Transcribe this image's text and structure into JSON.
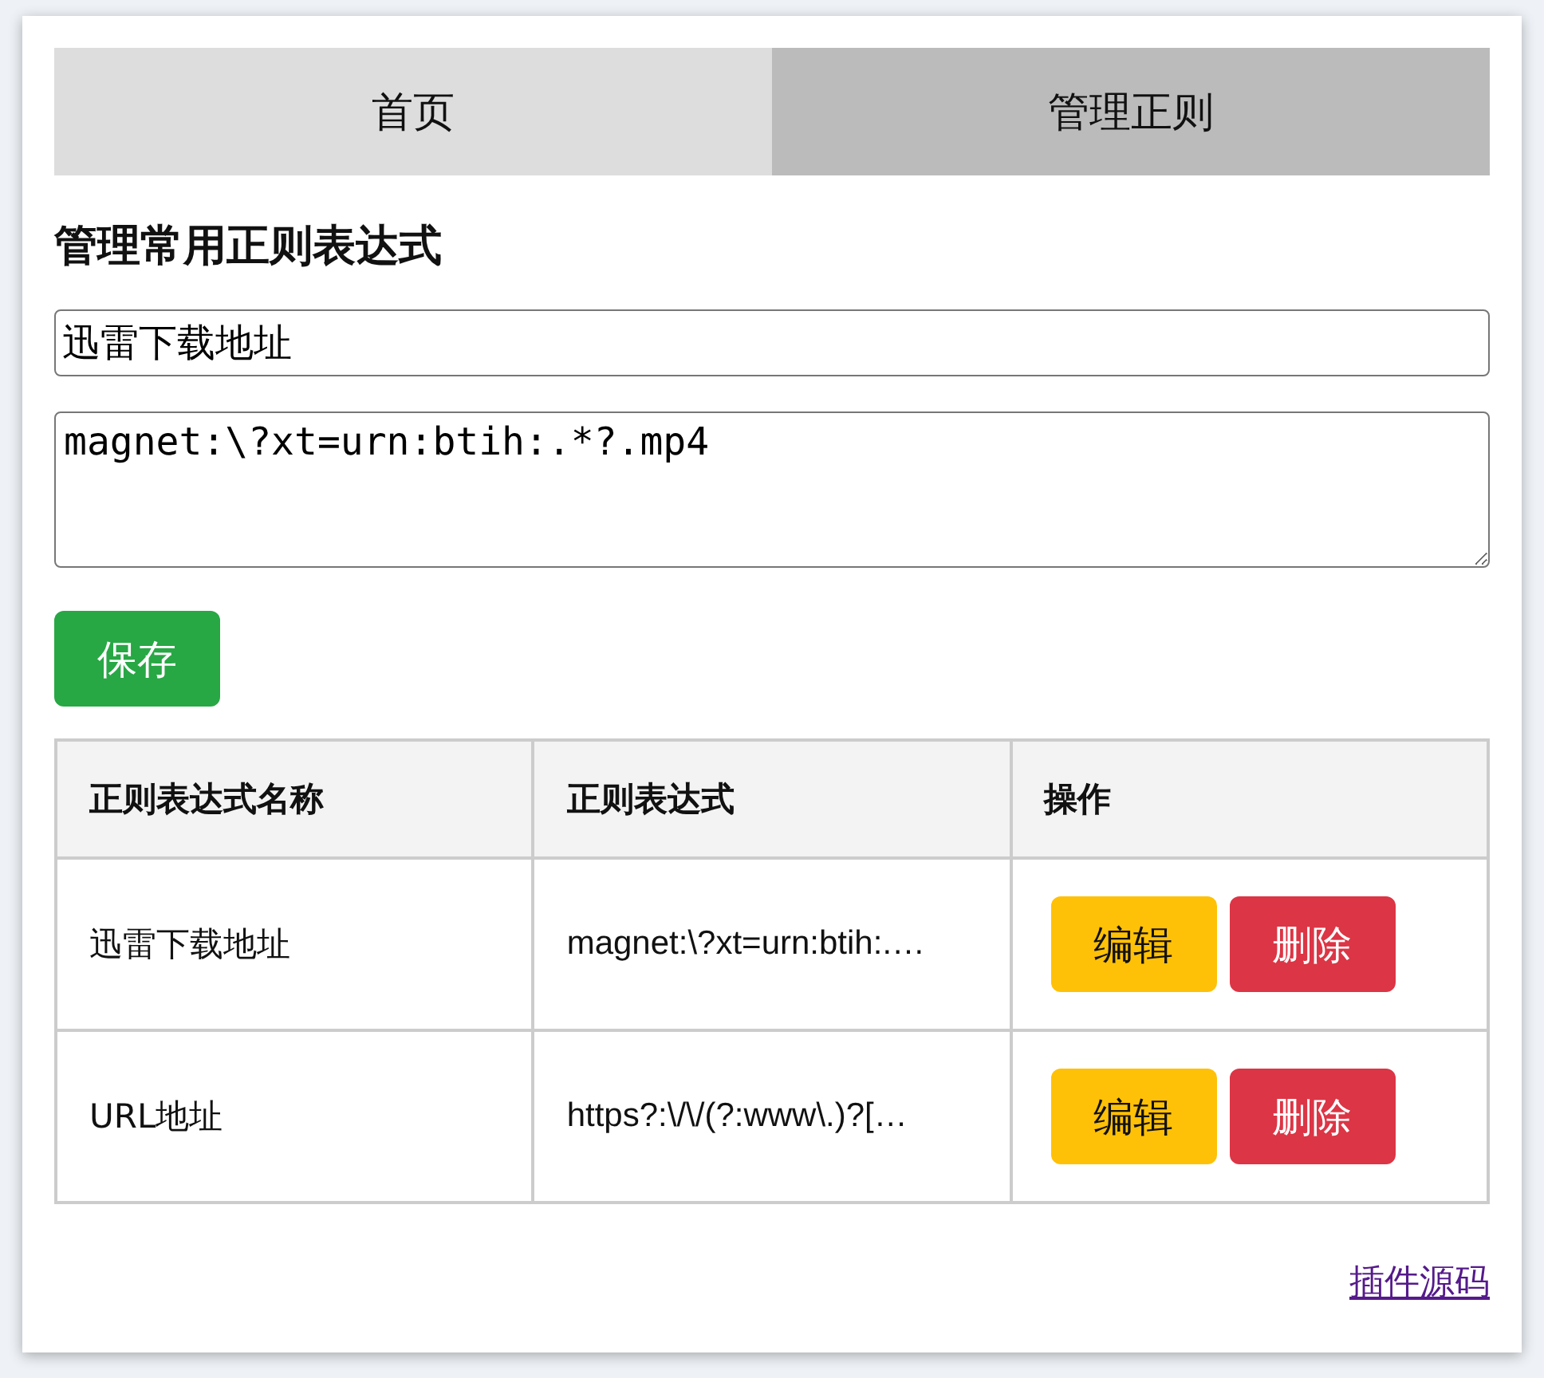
{
  "tabs": [
    {
      "label": "首页",
      "selected": false
    },
    {
      "label": "管理正则",
      "selected": true
    }
  ],
  "heading": "管理常用正则表达式",
  "name_field": {
    "value": "迅雷下载地址"
  },
  "regex_field": {
    "value": "magnet:\\?xt=urn:btih:.*?.mp4"
  },
  "save_button": "保存",
  "table": {
    "columns": [
      "正则表达式名称",
      "正则表达式",
      "操作"
    ],
    "rows": [
      {
        "name": "迅雷下载地址",
        "regex": "magnet:\\?xt=urn:btih:.…",
        "actions": [
          "编辑",
          "删除"
        ]
      },
      {
        "name": "URL地址",
        "regex": "https?:\\/\\/(?:www\\.)?[…",
        "actions": [
          "编辑",
          "删除"
        ]
      }
    ]
  },
  "footer_link": "插件源码"
}
